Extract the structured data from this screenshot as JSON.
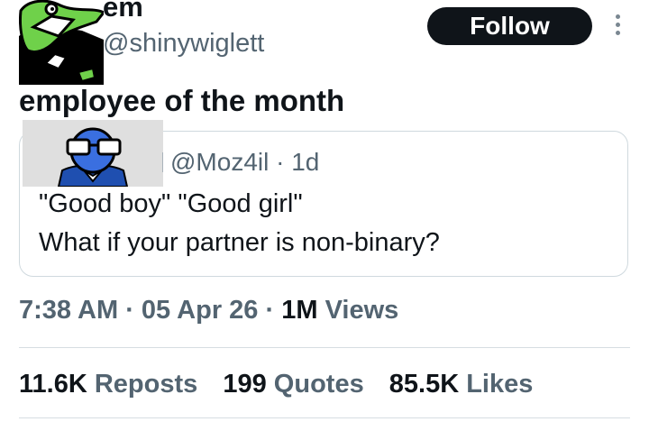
{
  "author": {
    "display_name": "em",
    "handle": "@shinywiglett",
    "follow_label": "Follow"
  },
  "tweet": {
    "text": "employee of the month",
    "time": "7:38 AM",
    "date": "05 Apr 26",
    "views_value": "1M",
    "views_label": "Views",
    "separator": "·"
  },
  "quoted": {
    "handle": "@Moz4il",
    "age": "1d",
    "line1": "\"Good boy\" \"Good girl\"",
    "line2": "What if your partner is non-binary?"
  },
  "stats": {
    "reposts_value": "11.6K",
    "reposts_label": "Reposts",
    "quotes_value": "199",
    "quotes_label": "Quotes",
    "likes_value": "85.5K",
    "likes_label": "Likes"
  },
  "icons": {
    "more": "more-vertical-icon"
  },
  "colors": {
    "text": "#0f1419",
    "secondary": "#536471",
    "border": "#cfd9de",
    "follow_bg": "#0f1419"
  }
}
